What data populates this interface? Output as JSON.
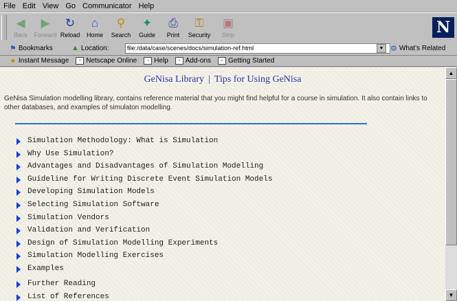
{
  "menu": [
    "File",
    "Edit",
    "View",
    "Go",
    "Communicator",
    "Help"
  ],
  "toolbar": {
    "buttons": [
      {
        "label": "Back",
        "icon": "back-arrow-icon",
        "disabled": true
      },
      {
        "label": "Forward",
        "icon": "forward-arrow-icon",
        "disabled": true
      },
      {
        "label": "Reload",
        "icon": "reload-icon",
        "disabled": false
      },
      {
        "label": "Home",
        "icon": "home-icon",
        "disabled": false
      },
      {
        "label": "Search",
        "icon": "search-icon",
        "disabled": false
      },
      {
        "label": "Guide",
        "icon": "guide-icon",
        "disabled": false
      },
      {
        "label": "Print",
        "icon": "print-icon",
        "disabled": false
      },
      {
        "label": "Security",
        "icon": "security-lock-icon",
        "disabled": false
      },
      {
        "label": "Stop",
        "icon": "stop-icon",
        "disabled": true
      }
    ],
    "logo": "N"
  },
  "location_bar": {
    "bookmarks_label": "Bookmarks",
    "location_label": "Location:",
    "url": "file:/data/case/scenes/docs/simulation-ref.html",
    "related_label": "What's Related"
  },
  "personal_toolbar": [
    "Instant Message",
    "Netscape Online",
    "Help",
    "Add-ons",
    "Getting Started"
  ],
  "page": {
    "title_left": "GeNisa Library",
    "title_sep": "|",
    "title_right": "Tips for Using GeNisa",
    "intro": "GeNisa Simulation modelling library, contains reference material that you might find helpful for a course in simulation. It also contain links to other databases, and examples of simulaton modelling.",
    "topics": [
      "Simulation Methodology: What is Simulation",
      "Why Use Simulation?",
      "Advantages and Disadvantages of Simulation Modelling",
      "Guideline for Writing Discrete Event Simulation Models",
      "Developing Simulation Models",
      "Selecting Simulation Software",
      "Simulation Vendors",
      "Validation and Verification",
      "Design of Simulation Modelling Experiments",
      "Simulation Modelling Exercises",
      "Examples"
    ],
    "more_topics": [
      "Further Reading",
      "List of References"
    ]
  },
  "colors": {
    "title": "#2a37a8",
    "rule": "#2277cc",
    "bullet": "#1c3fd0",
    "chrome": "#c0c0c0"
  }
}
